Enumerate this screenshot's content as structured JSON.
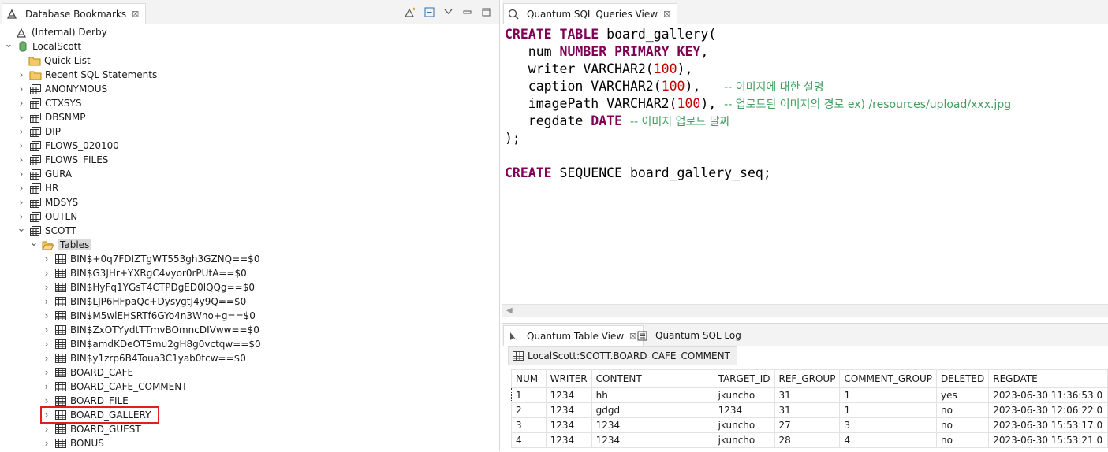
{
  "left_tab": {
    "title": "Database Bookmarks",
    "close": "⊠"
  },
  "tree": [
    {
      "label": "(Internal) Derby",
      "icon": "derby-bookmark-icon",
      "indent": 1,
      "twisty": ""
    },
    {
      "label": "LocalScott",
      "icon": "database-icon",
      "indent": 0,
      "twisty": "⌄"
    },
    {
      "label": "Quick List",
      "icon": "folder-icon",
      "indent": 2,
      "twisty": ""
    },
    {
      "label": "Recent SQL Statements",
      "icon": "folder-icon",
      "indent": 1,
      "twisty": "›"
    },
    {
      "label": "ANONYMOUS",
      "icon": "schema-icon",
      "indent": 1,
      "twisty": "›"
    },
    {
      "label": "CTXSYS",
      "icon": "schema-icon",
      "indent": 1,
      "twisty": "›"
    },
    {
      "label": "DBSNMP",
      "icon": "schema-icon",
      "indent": 1,
      "twisty": "›"
    },
    {
      "label": "DIP",
      "icon": "schema-icon",
      "indent": 1,
      "twisty": "›"
    },
    {
      "label": "FLOWS_020100",
      "icon": "schema-icon",
      "indent": 1,
      "twisty": "›"
    },
    {
      "label": "FLOWS_FILES",
      "icon": "schema-icon",
      "indent": 1,
      "twisty": "›"
    },
    {
      "label": "GURA",
      "icon": "schema-icon",
      "indent": 1,
      "twisty": "›"
    },
    {
      "label": "HR",
      "icon": "schema-icon",
      "indent": 1,
      "twisty": "›"
    },
    {
      "label": "MDSYS",
      "icon": "schema-icon",
      "indent": 1,
      "twisty": "›"
    },
    {
      "label": "OUTLN",
      "icon": "schema-icon",
      "indent": 1,
      "twisty": "›"
    },
    {
      "label": "SCOTT",
      "icon": "schema-icon",
      "indent": 1,
      "twisty": "⌄"
    },
    {
      "label": "Tables",
      "icon": "folder-open-icon",
      "indent": 2,
      "twisty": "⌄"
    },
    {
      "label": "BIN$+0q7FDIZTgWT553gh3GZNQ==$0",
      "icon": "table-icon",
      "indent": 3,
      "twisty": "›"
    },
    {
      "label": "BIN$G3JHr+YXRgC4vyor0rPUtA==$0",
      "icon": "table-icon",
      "indent": 3,
      "twisty": "›"
    },
    {
      "label": "BIN$HyFq1YGsT4CTPDgED0lQQg==$0",
      "icon": "table-icon",
      "indent": 3,
      "twisty": "›"
    },
    {
      "label": "BIN$LJP6HFpaQc+DysygtJ4y9Q==$0",
      "icon": "table-icon",
      "indent": 3,
      "twisty": "›"
    },
    {
      "label": "BIN$M5wlEHSRTf6GYo4n3Wno+g==$0",
      "icon": "table-icon",
      "indent": 3,
      "twisty": "›"
    },
    {
      "label": "BIN$ZxOTYydtTTmvBOmncDIVww==$0",
      "icon": "table-icon",
      "indent": 3,
      "twisty": "›"
    },
    {
      "label": "BIN$amdKDeOTSmu2gH8g0vctqw==$0",
      "icon": "table-icon",
      "indent": 3,
      "twisty": "›"
    },
    {
      "label": "BIN$y1zrp6B4Toua3C1yab0tcw==$0",
      "icon": "table-icon",
      "indent": 3,
      "twisty": "›"
    },
    {
      "label": "BOARD_CAFE",
      "icon": "table-icon",
      "indent": 3,
      "twisty": "›"
    },
    {
      "label": "BOARD_CAFE_COMMENT",
      "icon": "table-icon",
      "indent": 3,
      "twisty": "›"
    },
    {
      "label": "BOARD_FILE",
      "icon": "table-icon",
      "indent": 3,
      "twisty": "›"
    },
    {
      "label": "BOARD_GALLERY",
      "icon": "table-icon",
      "indent": 3,
      "twisty": "›"
    },
    {
      "label": "BOARD_GUEST",
      "icon": "table-icon",
      "indent": 3,
      "twisty": "›"
    },
    {
      "label": "BONUS",
      "icon": "table-icon",
      "indent": 3,
      "twisty": "›"
    }
  ],
  "editor_tab": {
    "title": "Quantum SQL Queries View",
    "close": "⊠"
  },
  "sql_lines": [
    [
      {
        "t": "CREATE TABLE ",
        "k": "kw"
      },
      {
        "t": "board_gallery(",
        "k": ""
      }
    ],
    [
      {
        "t": "   num ",
        "k": ""
      },
      {
        "t": "NUMBER PRIMARY KEY",
        "k": "kw"
      },
      {
        "t": ",",
        "k": ""
      }
    ],
    [
      {
        "t": "   writer VARCHAR2(",
        "k": ""
      },
      {
        "t": "100",
        "k": "num"
      },
      {
        "t": "),",
        "k": ""
      }
    ],
    [
      {
        "t": "   caption VARCHAR2(",
        "k": ""
      },
      {
        "t": "100",
        "k": "num"
      },
      {
        "t": "),   ",
        "k": ""
      },
      {
        "t": "-- 이미지에 대한 설명",
        "k": "cm"
      }
    ],
    [
      {
        "t": "   imagePath VARCHAR2(",
        "k": ""
      },
      {
        "t": "100",
        "k": "num"
      },
      {
        "t": "), ",
        "k": ""
      },
      {
        "t": "-- 업로드된 이미지의 경로 ex) /resources/upload/xxx.jpg",
        "k": "cm"
      }
    ],
    [
      {
        "t": "   regdate ",
        "k": ""
      },
      {
        "t": "DATE",
        "k": "kw"
      },
      {
        "t": " ",
        "k": ""
      },
      {
        "t": "-- 이미지 업로드 날짜",
        "k": "cm"
      }
    ],
    [
      {
        "t": ");",
        "k": ""
      }
    ],
    [
      {
        "t": "",
        "k": ""
      }
    ],
    [
      {
        "t": "CREATE",
        "k": "kw"
      },
      {
        "t": " SEQUENCE board_gallery_seq;",
        "k": ""
      }
    ]
  ],
  "table_tabs": {
    "table_view": "Quantum Table View",
    "close": "⊠",
    "sql_log": "Quantum SQL Log"
  },
  "result_title": "LocalScott:SCOTT.BOARD_CAFE_COMMENT",
  "columns": [
    "NUM",
    "WRITER",
    "CONTENT",
    "TARGET_ID",
    "REF_GROUP",
    "COMMENT_GROUP",
    "DELETED",
    "REGDATE"
  ],
  "rows": [
    [
      "1",
      "1234",
      "hh",
      "jkuncho",
      "31",
      "1",
      "yes",
      "2023-06-30 11:36:53.0"
    ],
    [
      "2",
      "1234",
      "gdgd",
      "1234",
      "31",
      "1",
      "no",
      "2023-06-30 12:06:22.0"
    ],
    [
      "3",
      "1234",
      "1234",
      "jkuncho",
      "27",
      "3",
      "no",
      "2023-06-30 15:53:17.0"
    ],
    [
      "4",
      "1234",
      "1234",
      "jkuncho",
      "28",
      "4",
      "no",
      "2023-06-30 15:53:21.0"
    ]
  ],
  "colors": {
    "keyword": "#7f0055",
    "number": "#c00000",
    "comment": "#3f9f5f",
    "highlight": "#e02020"
  }
}
